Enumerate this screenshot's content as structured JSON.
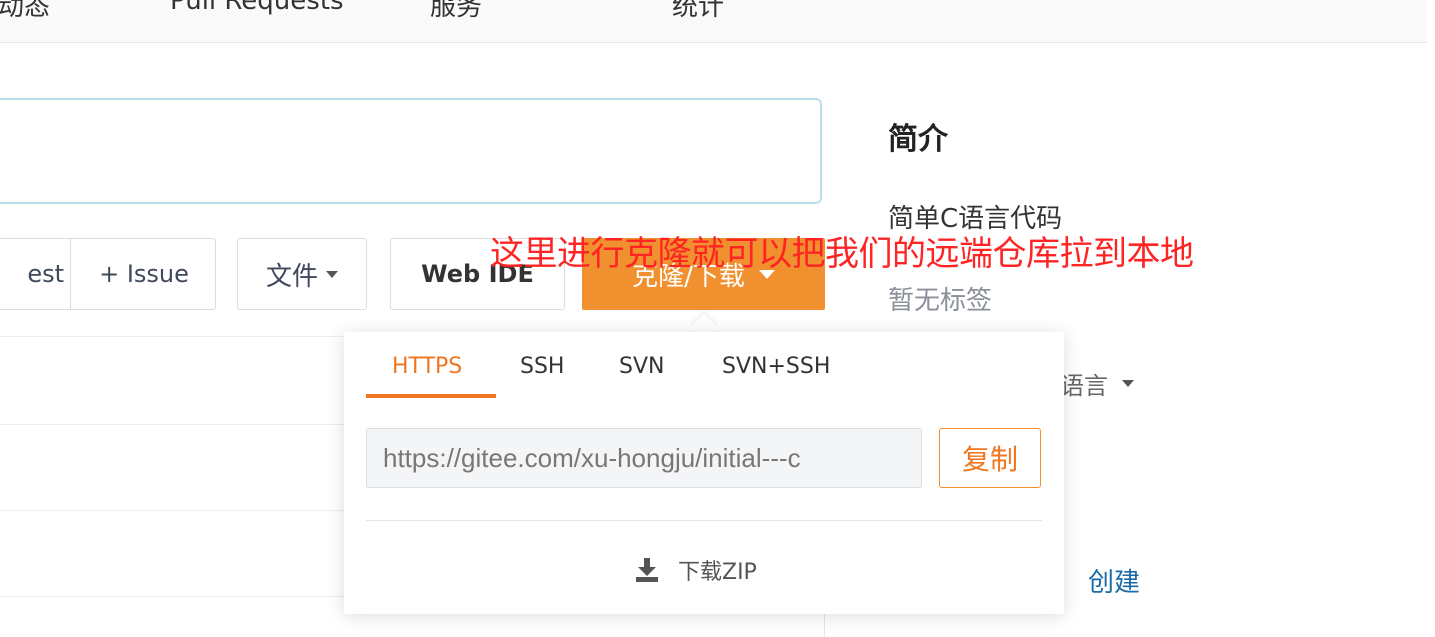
{
  "nav": {
    "items": [
      "动态",
      "Pull Requests",
      "服务",
      "统计"
    ]
  },
  "toolbar": {
    "pull_request_partial": "est",
    "issue_label": "+ Issue",
    "file_label": "文件",
    "webide_label": "Web IDE",
    "clone_label": "克隆/下载"
  },
  "sidebar": {
    "title": "简介",
    "description": "简单C语言代码",
    "tags": "暂无标签",
    "language": "语言",
    "create": "创建"
  },
  "annotation": "这里进行克隆就可以把我们的远端仓库拉到本地",
  "clone_dropdown": {
    "tabs": [
      "HTTPS",
      "SSH",
      "SVN",
      "SVN+SSH"
    ],
    "active_tab": "HTTPS",
    "url": "https://gitee.com/xu-hongju/initial---c",
    "copy_label": "复制",
    "download_zip": "下载ZIP"
  },
  "colors": {
    "accent": "#f0902f",
    "annotation": "#ff2424",
    "link": "#1a6aa8"
  }
}
